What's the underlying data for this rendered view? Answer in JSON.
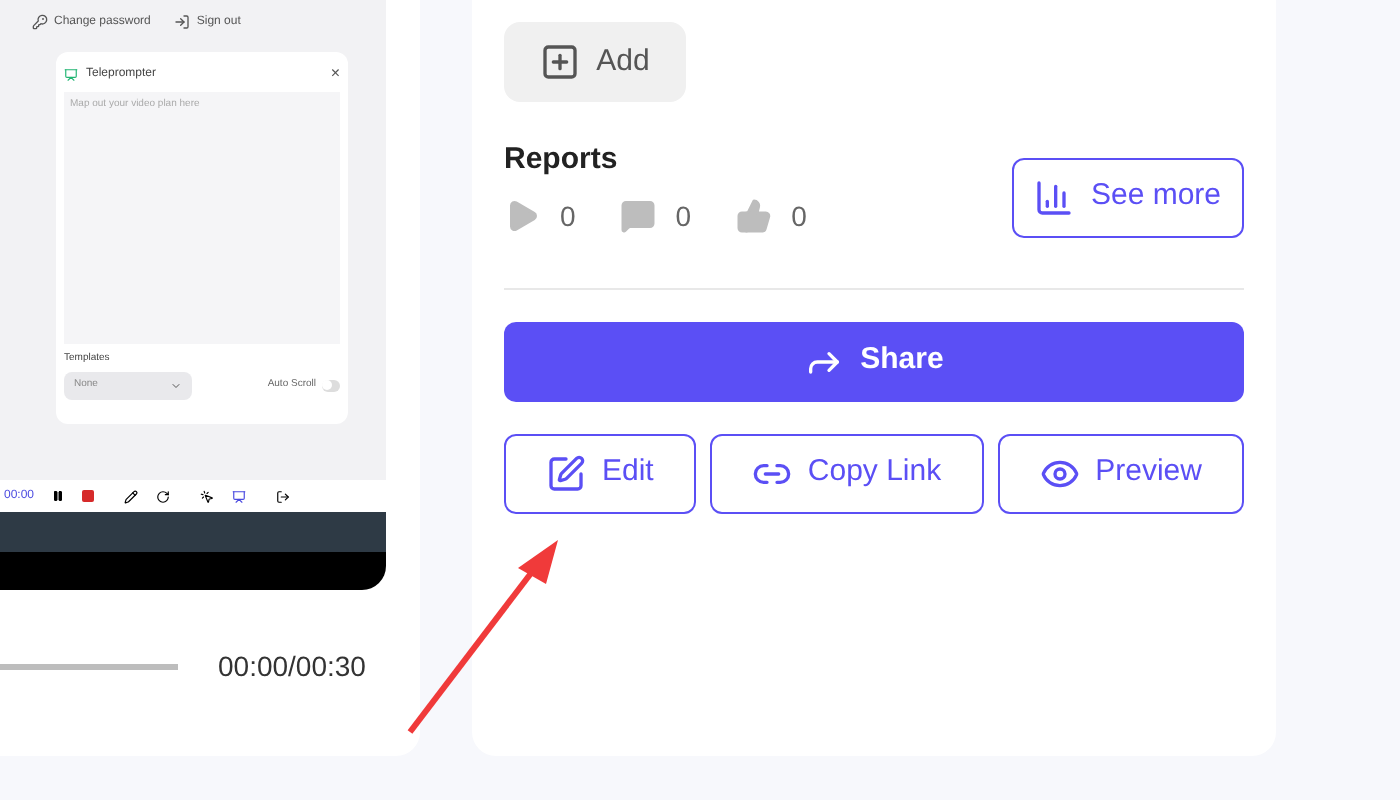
{
  "video_preview": {
    "account_menu": [
      {
        "kind": "key",
        "label": "Change password"
      },
      {
        "kind": "signout",
        "label": "Sign out"
      }
    ],
    "teleprompter": {
      "title": "Teleprompter",
      "close": "×",
      "placeholder": "Map out your video plan here",
      "templates_label": "Templates",
      "template_value": "None",
      "auto_scroll": {
        "label": "Auto Scroll",
        "on": false
      }
    },
    "toolbar": {
      "timer": "00:00"
    },
    "player": {
      "time": "00:00/00:30"
    }
  },
  "tags": {
    "add_button": "Add"
  },
  "reports": {
    "title": "Reports",
    "stats": [
      {
        "kind": "views",
        "count": "0"
      },
      {
        "kind": "comments",
        "count": "0"
      },
      {
        "kind": "likes",
        "count": "0"
      }
    ],
    "see_more": "See more"
  },
  "actions": {
    "share": "Share",
    "buttons": [
      {
        "kind": "edit",
        "label": "Edit"
      },
      {
        "kind": "link",
        "label": "Copy Link"
      },
      {
        "kind": "preview",
        "label": "Preview"
      }
    ]
  }
}
